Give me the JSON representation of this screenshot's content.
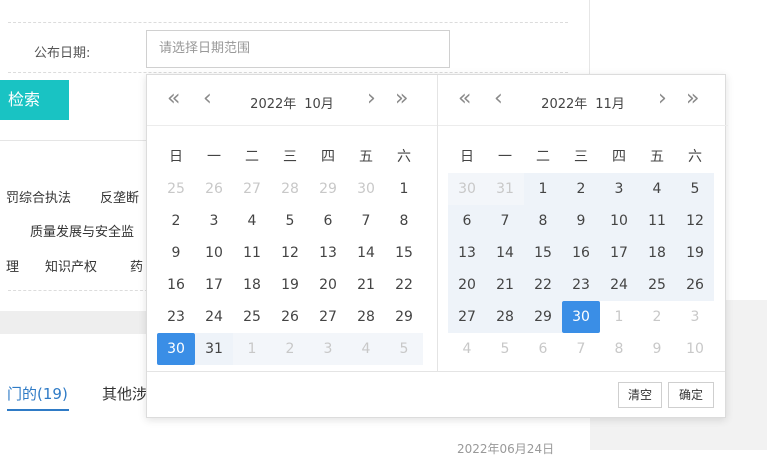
{
  "filter": {
    "publish_date_label": "公布日期:",
    "date_input_placeholder": "请选择日期范围"
  },
  "search_button_label": "检索",
  "categories": {
    "row1": [
      "罚综合执法",
      "反垄断"
    ],
    "row2": [
      "质量发展与安全监"
    ],
    "row3": [
      "理",
      "知识产权",
      "药"
    ]
  },
  "results": {
    "active_tab_label": "门的(19)",
    "other_tab_label": "其他涉",
    "item_date_partial": "2022年06月24日"
  },
  "date_picker": {
    "weekday_headers": [
      "日",
      "一",
      "二",
      "三",
      "四",
      "五",
      "六"
    ],
    "nav_icons": {
      "prev_year": "double-chevron-left-icon",
      "prev_month": "chevron-left-icon",
      "next_month": "chevron-right-icon",
      "next_year": "double-chevron-right-icon"
    },
    "left_month": {
      "year_label": "2022年",
      "month_label": "10月",
      "weeks": [
        [
          {
            "d": "25",
            "o": true,
            "r": false,
            "s": false
          },
          {
            "d": "26",
            "o": true,
            "r": false,
            "s": false
          },
          {
            "d": "27",
            "o": true,
            "r": false,
            "s": false
          },
          {
            "d": "28",
            "o": true,
            "r": false,
            "s": false
          },
          {
            "d": "29",
            "o": true,
            "r": false,
            "s": false
          },
          {
            "d": "30",
            "o": true,
            "r": false,
            "s": false
          },
          {
            "d": "1",
            "o": false,
            "r": false,
            "s": false
          }
        ],
        [
          {
            "d": "2",
            "o": false,
            "r": false,
            "s": false
          },
          {
            "d": "3",
            "o": false,
            "r": false,
            "s": false
          },
          {
            "d": "4",
            "o": false,
            "r": false,
            "s": false
          },
          {
            "d": "5",
            "o": false,
            "r": false,
            "s": false
          },
          {
            "d": "6",
            "o": false,
            "r": false,
            "s": false
          },
          {
            "d": "7",
            "o": false,
            "r": false,
            "s": false
          },
          {
            "d": "8",
            "o": false,
            "r": false,
            "s": false
          }
        ],
        [
          {
            "d": "9",
            "o": false,
            "r": false,
            "s": false
          },
          {
            "d": "10",
            "o": false,
            "r": false,
            "s": false
          },
          {
            "d": "11",
            "o": false,
            "r": false,
            "s": false
          },
          {
            "d": "12",
            "o": false,
            "r": false,
            "s": false
          },
          {
            "d": "13",
            "o": false,
            "r": false,
            "s": false
          },
          {
            "d": "14",
            "o": false,
            "r": false,
            "s": false
          },
          {
            "d": "15",
            "o": false,
            "r": false,
            "s": false
          }
        ],
        [
          {
            "d": "16",
            "o": false,
            "r": false,
            "s": false
          },
          {
            "d": "17",
            "o": false,
            "r": false,
            "s": false
          },
          {
            "d": "18",
            "o": false,
            "r": false,
            "s": false
          },
          {
            "d": "19",
            "o": false,
            "r": false,
            "s": false
          },
          {
            "d": "20",
            "o": false,
            "r": false,
            "s": false
          },
          {
            "d": "21",
            "o": false,
            "r": false,
            "s": false
          },
          {
            "d": "22",
            "o": false,
            "r": false,
            "s": false
          }
        ],
        [
          {
            "d": "23",
            "o": false,
            "r": false,
            "s": false
          },
          {
            "d": "24",
            "o": false,
            "r": false,
            "s": false
          },
          {
            "d": "25",
            "o": false,
            "r": false,
            "s": false
          },
          {
            "d": "26",
            "o": false,
            "r": false,
            "s": false
          },
          {
            "d": "27",
            "o": false,
            "r": false,
            "s": false
          },
          {
            "d": "28",
            "o": false,
            "r": false,
            "s": false
          },
          {
            "d": "29",
            "o": false,
            "r": false,
            "s": false
          }
        ],
        [
          {
            "d": "30",
            "o": false,
            "r": true,
            "s": true
          },
          {
            "d": "31",
            "o": false,
            "r": true,
            "s": false
          },
          {
            "d": "1",
            "o": true,
            "r": true,
            "s": false
          },
          {
            "d": "2",
            "o": true,
            "r": true,
            "s": false
          },
          {
            "d": "3",
            "o": true,
            "r": true,
            "s": false
          },
          {
            "d": "4",
            "o": true,
            "r": true,
            "s": false
          },
          {
            "d": "5",
            "o": true,
            "r": true,
            "s": false
          }
        ]
      ]
    },
    "right_month": {
      "year_label": "2022年",
      "month_label": "11月",
      "weeks": [
        [
          {
            "d": "30",
            "o": true,
            "r": true,
            "s": false
          },
          {
            "d": "31",
            "o": true,
            "r": true,
            "s": false
          },
          {
            "d": "1",
            "o": false,
            "r": true,
            "s": false
          },
          {
            "d": "2",
            "o": false,
            "r": true,
            "s": false
          },
          {
            "d": "3",
            "o": false,
            "r": true,
            "s": false
          },
          {
            "d": "4",
            "o": false,
            "r": true,
            "s": false
          },
          {
            "d": "5",
            "o": false,
            "r": true,
            "s": false
          }
        ],
        [
          {
            "d": "6",
            "o": false,
            "r": true,
            "s": false
          },
          {
            "d": "7",
            "o": false,
            "r": true,
            "s": false
          },
          {
            "d": "8",
            "o": false,
            "r": true,
            "s": false
          },
          {
            "d": "9",
            "o": false,
            "r": true,
            "s": false
          },
          {
            "d": "10",
            "o": false,
            "r": true,
            "s": false
          },
          {
            "d": "11",
            "o": false,
            "r": true,
            "s": false
          },
          {
            "d": "12",
            "o": false,
            "r": true,
            "s": false
          }
        ],
        [
          {
            "d": "13",
            "o": false,
            "r": true,
            "s": false
          },
          {
            "d": "14",
            "o": false,
            "r": true,
            "s": false
          },
          {
            "d": "15",
            "o": false,
            "r": true,
            "s": false
          },
          {
            "d": "16",
            "o": false,
            "r": true,
            "s": false
          },
          {
            "d": "17",
            "o": false,
            "r": true,
            "s": false
          },
          {
            "d": "18",
            "o": false,
            "r": true,
            "s": false
          },
          {
            "d": "19",
            "o": false,
            "r": true,
            "s": false
          }
        ],
        [
          {
            "d": "20",
            "o": false,
            "r": true,
            "s": false
          },
          {
            "d": "21",
            "o": false,
            "r": true,
            "s": false
          },
          {
            "d": "22",
            "o": false,
            "r": true,
            "s": false
          },
          {
            "d": "23",
            "o": false,
            "r": true,
            "s": false
          },
          {
            "d": "24",
            "o": false,
            "r": true,
            "s": false
          },
          {
            "d": "25",
            "o": false,
            "r": true,
            "s": false
          },
          {
            "d": "26",
            "o": false,
            "r": true,
            "s": false
          }
        ],
        [
          {
            "d": "27",
            "o": false,
            "r": true,
            "s": false
          },
          {
            "d": "28",
            "o": false,
            "r": true,
            "s": false
          },
          {
            "d": "29",
            "o": false,
            "r": true,
            "s": false
          },
          {
            "d": "30",
            "o": false,
            "r": false,
            "s": true
          },
          {
            "d": "1",
            "o": true,
            "r": false,
            "s": false
          },
          {
            "d": "2",
            "o": true,
            "r": false,
            "s": false
          },
          {
            "d": "3",
            "o": true,
            "r": false,
            "s": false
          }
        ],
        [
          {
            "d": "4",
            "o": true,
            "r": false,
            "s": false
          },
          {
            "d": "5",
            "o": true,
            "r": false,
            "s": false
          },
          {
            "d": "6",
            "o": true,
            "r": false,
            "s": false
          },
          {
            "d": "7",
            "o": true,
            "r": false,
            "s": false
          },
          {
            "d": "8",
            "o": true,
            "r": false,
            "s": false
          },
          {
            "d": "9",
            "o": true,
            "r": false,
            "s": false
          },
          {
            "d": "10",
            "o": true,
            "r": false,
            "s": false
          }
        ]
      ]
    },
    "clear_button_label": "清空",
    "confirm_button_label": "确定"
  },
  "colors": {
    "accent": "#3a8ee6",
    "search_button": "#19c3c3",
    "link_blue": "#2f7bc6",
    "range_bg": "#eef3f9"
  }
}
